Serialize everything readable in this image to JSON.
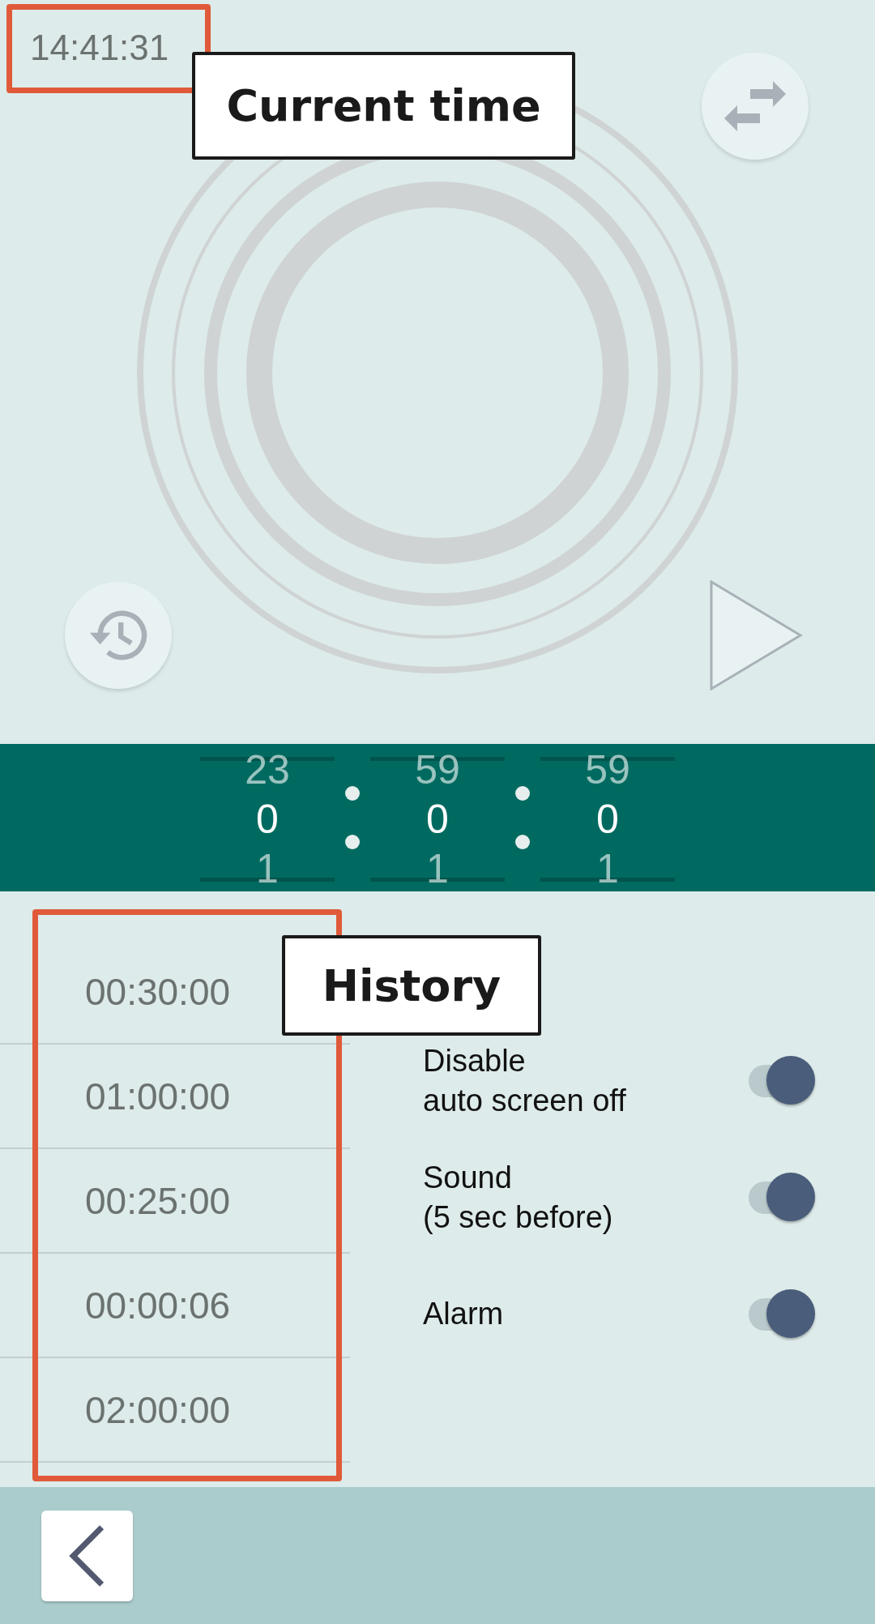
{
  "current_time": "14:41:31",
  "callouts": [
    {
      "text": "Current time"
    },
    {
      "text": "History"
    }
  ],
  "picker": [
    {
      "above": "23",
      "value": "0",
      "below": "1"
    },
    {
      "above": "59",
      "value": "0",
      "below": "1"
    },
    {
      "above": "59",
      "value": "0",
      "below": "1"
    }
  ],
  "history": [
    "00:30:00",
    "01:00:00",
    "00:25:00",
    "00:00:06",
    "02:00:00"
  ],
  "settings": [
    {
      "label": "Disable\nauto screen off",
      "on": true
    },
    {
      "label": "Sound\n(5 sec before)",
      "on": true
    },
    {
      "label": "Alarm",
      "on": true
    }
  ]
}
